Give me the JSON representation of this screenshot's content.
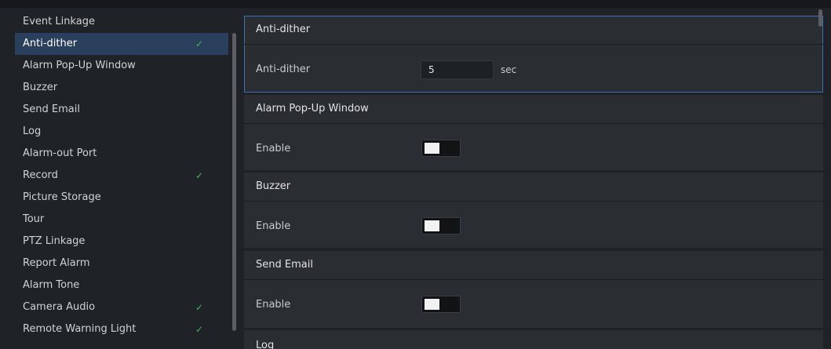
{
  "sidebar": {
    "items": [
      {
        "label": "Event Linkage",
        "checked": false
      },
      {
        "label": "Anti-dither",
        "checked": true
      },
      {
        "label": "Alarm Pop-Up Window",
        "checked": false
      },
      {
        "label": "Buzzer",
        "checked": false
      },
      {
        "label": "Send Email",
        "checked": false
      },
      {
        "label": "Log",
        "checked": false
      },
      {
        "label": "Alarm-out Port",
        "checked": false
      },
      {
        "label": "Record",
        "checked": true
      },
      {
        "label": "Picture Storage",
        "checked": false
      },
      {
        "label": "Tour",
        "checked": false
      },
      {
        "label": "PTZ Linkage",
        "checked": false
      },
      {
        "label": "Report Alarm",
        "checked": false
      },
      {
        "label": "Alarm Tone",
        "checked": false
      },
      {
        "label": "Camera Audio",
        "checked": true
      },
      {
        "label": "Remote Warning Light",
        "checked": true
      }
    ],
    "active_index": 1,
    "check_glyph": "✓"
  },
  "sections": {
    "anti_dither": {
      "title": "Anti-dither",
      "field_label": "Anti-dither",
      "value": "5",
      "unit": "sec"
    },
    "alarm_popup": {
      "title": "Alarm Pop-Up Window",
      "enable_label": "Enable",
      "enabled": false
    },
    "buzzer": {
      "title": "Buzzer",
      "enable_label": "Enable",
      "enabled": false
    },
    "send_email": {
      "title": "Send Email",
      "enable_label": "Enable",
      "enabled": false
    },
    "log": {
      "title": "Log"
    }
  },
  "colors": {
    "accent": "#3d6fb5",
    "check": "#3fb950",
    "active_item": "#2a3f5c"
  }
}
